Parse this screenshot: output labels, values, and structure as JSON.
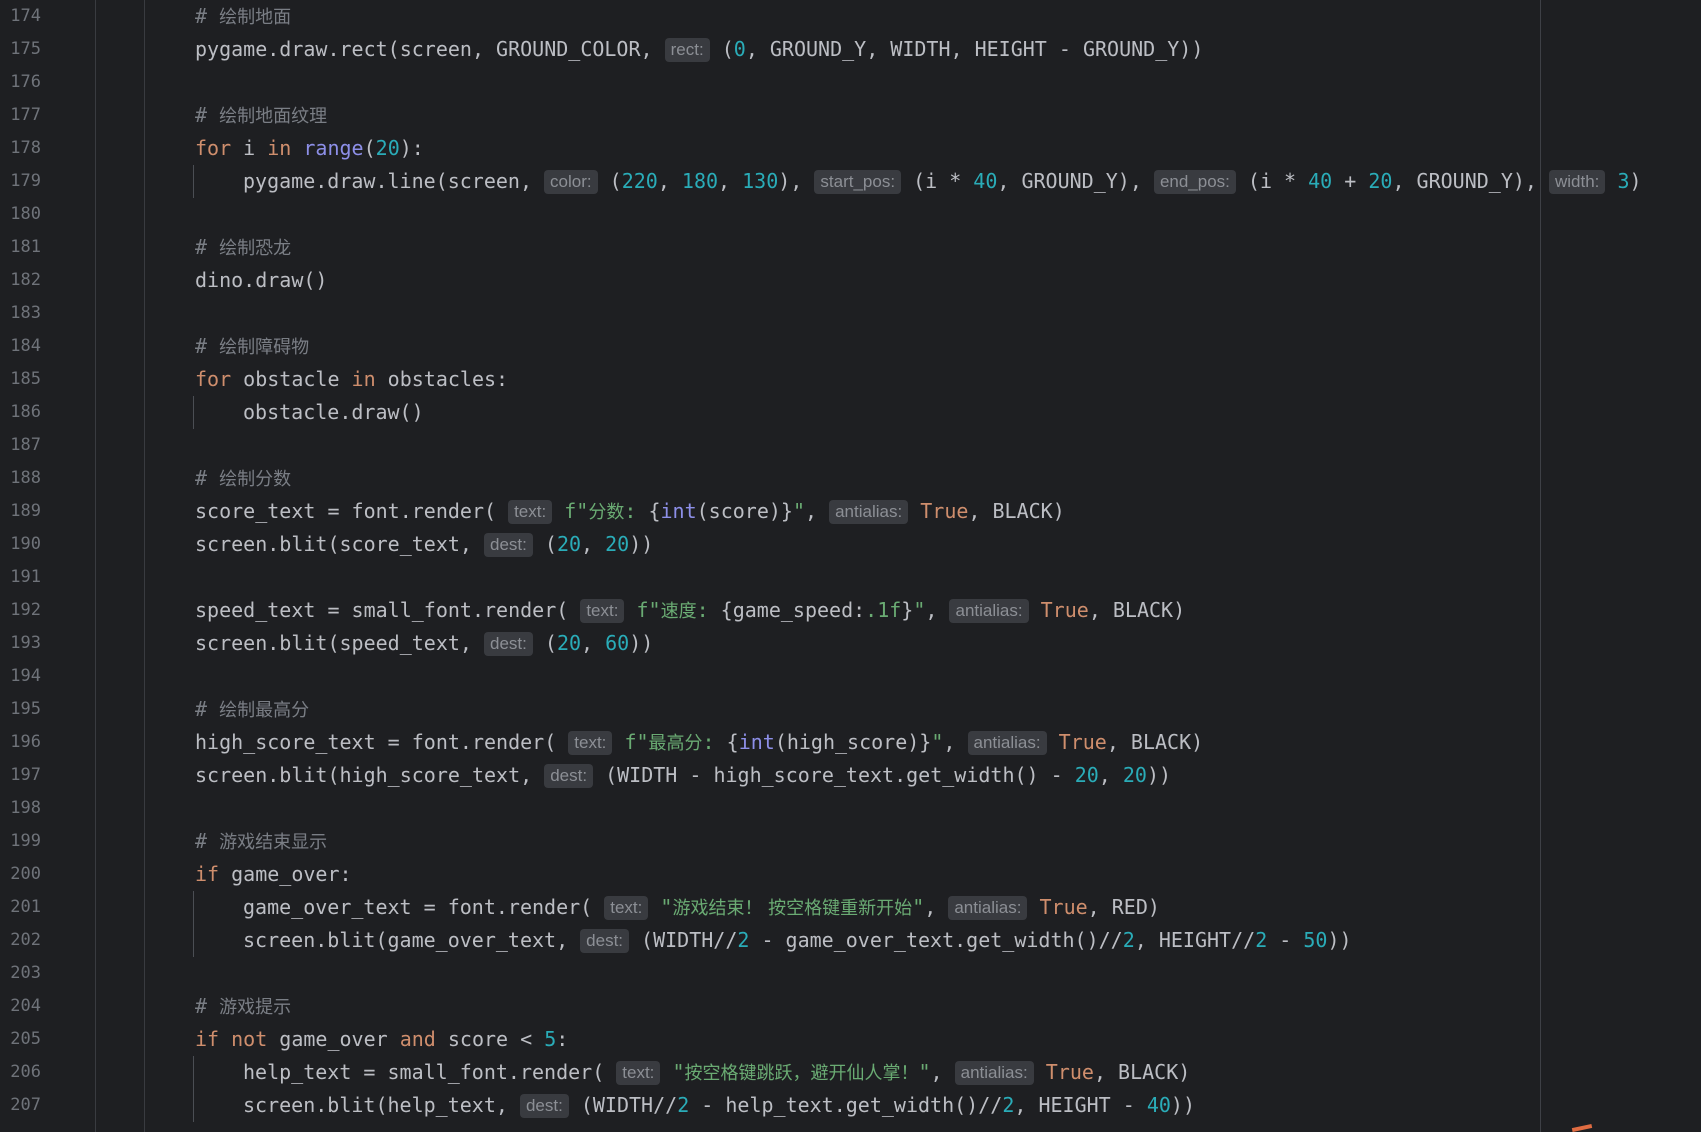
{
  "editor": {
    "lines": [
      {
        "n": "174",
        "indent": 1,
        "segs": [
          {
            "c": "cmt",
            "t": "# "
          },
          {
            "c": "cmt cjk",
            "t": "绘制地面"
          }
        ]
      },
      {
        "n": "175",
        "indent": 1,
        "segs": [
          {
            "t": "pygame.draw.rect(screen, GROUND_COLOR, "
          },
          {
            "h": "rect:"
          },
          {
            "t": " ("
          },
          {
            "c": "num",
            "t": "0"
          },
          {
            "t": ", GROUND_Y, WIDTH, HEIGHT - GROUND_Y))"
          }
        ]
      },
      {
        "n": "176",
        "indent": 0,
        "segs": []
      },
      {
        "n": "177",
        "indent": 1,
        "segs": [
          {
            "c": "cmt",
            "t": "# "
          },
          {
            "c": "cmt cjk",
            "t": "绘制地面纹理"
          }
        ]
      },
      {
        "n": "178",
        "indent": 1,
        "segs": [
          {
            "c": "kw",
            "t": "for"
          },
          {
            "t": " i "
          },
          {
            "c": "kw",
            "t": "in"
          },
          {
            "t": " "
          },
          {
            "c": "fn",
            "t": "range"
          },
          {
            "t": "("
          },
          {
            "c": "num",
            "t": "20"
          },
          {
            "t": "):"
          }
        ]
      },
      {
        "n": "179",
        "indent": 2,
        "segs": [
          {
            "t": "pygame.draw.line(screen, "
          },
          {
            "h": "color:"
          },
          {
            "t": " ("
          },
          {
            "c": "num",
            "t": "220"
          },
          {
            "t": ", "
          },
          {
            "c": "num",
            "t": "180"
          },
          {
            "t": ", "
          },
          {
            "c": "num",
            "t": "130"
          },
          {
            "t": "), "
          },
          {
            "h": "start_pos:"
          },
          {
            "t": " (i * "
          },
          {
            "c": "num",
            "t": "40"
          },
          {
            "t": ", GROUND_Y), "
          },
          {
            "h": "end_pos:"
          },
          {
            "t": " (i * "
          },
          {
            "c": "num",
            "t": "40"
          },
          {
            "t": " + "
          },
          {
            "c": "num",
            "t": "20"
          },
          {
            "t": ", GROUND_Y), "
          },
          {
            "h": "width:"
          },
          {
            "t": " "
          },
          {
            "c": "num",
            "t": "3"
          },
          {
            "t": ")"
          }
        ]
      },
      {
        "n": "180",
        "indent": 0,
        "segs": []
      },
      {
        "n": "181",
        "indent": 1,
        "segs": [
          {
            "c": "cmt",
            "t": "# "
          },
          {
            "c": "cmt cjk",
            "t": "绘制恐龙"
          }
        ]
      },
      {
        "n": "182",
        "indent": 1,
        "segs": [
          {
            "t": "dino.draw()"
          }
        ]
      },
      {
        "n": "183",
        "indent": 0,
        "segs": []
      },
      {
        "n": "184",
        "indent": 1,
        "segs": [
          {
            "c": "cmt",
            "t": "# "
          },
          {
            "c": "cmt cjk",
            "t": "绘制障碍物"
          }
        ]
      },
      {
        "n": "185",
        "indent": 1,
        "segs": [
          {
            "c": "kw",
            "t": "for"
          },
          {
            "t": " obstacle "
          },
          {
            "c": "kw",
            "t": "in"
          },
          {
            "t": " obstacles:"
          }
        ]
      },
      {
        "n": "186",
        "indent": 2,
        "segs": [
          {
            "t": "obstacle.draw()"
          }
        ]
      },
      {
        "n": "187",
        "indent": 0,
        "segs": []
      },
      {
        "n": "188",
        "indent": 1,
        "segs": [
          {
            "c": "cmt",
            "t": "# "
          },
          {
            "c": "cmt cjk",
            "t": "绘制分数"
          }
        ]
      },
      {
        "n": "189",
        "indent": 1,
        "segs": [
          {
            "t": "score_text = font.render( "
          },
          {
            "h": "text:"
          },
          {
            "t": " "
          },
          {
            "c": "str",
            "t": "f\""
          },
          {
            "c": "str cjk",
            "t": "分数"
          },
          {
            "c": "str",
            "t": ": "
          },
          {
            "t": "{"
          },
          {
            "c": "fn",
            "t": "int"
          },
          {
            "t": "(score)}"
          },
          {
            "c": "str",
            "t": "\""
          },
          {
            "t": ", "
          },
          {
            "h": "antialias:"
          },
          {
            "t": " "
          },
          {
            "c": "kw",
            "t": "True"
          },
          {
            "t": ", BLACK)"
          }
        ]
      },
      {
        "n": "190",
        "indent": 1,
        "segs": [
          {
            "t": "screen.blit(score_text, "
          },
          {
            "h": "dest:"
          },
          {
            "t": " ("
          },
          {
            "c": "num",
            "t": "20"
          },
          {
            "t": ", "
          },
          {
            "c": "num",
            "t": "20"
          },
          {
            "t": "))"
          }
        ]
      },
      {
        "n": "191",
        "indent": 0,
        "segs": []
      },
      {
        "n": "192",
        "indent": 1,
        "segs": [
          {
            "t": "speed_text = small_font.render( "
          },
          {
            "h": "text:"
          },
          {
            "t": " "
          },
          {
            "c": "str",
            "t": "f\""
          },
          {
            "c": "str cjk",
            "t": "速度"
          },
          {
            "c": "str",
            "t": ": "
          },
          {
            "t": "{game_speed:"
          },
          {
            "c": "str",
            "t": ".1f"
          },
          {
            "t": "}"
          },
          {
            "c": "str",
            "t": "\""
          },
          {
            "t": ", "
          },
          {
            "h": "antialias:"
          },
          {
            "t": " "
          },
          {
            "c": "kw",
            "t": "True"
          },
          {
            "t": ", BLACK)"
          }
        ]
      },
      {
        "n": "193",
        "indent": 1,
        "segs": [
          {
            "t": "screen.blit(speed_text, "
          },
          {
            "h": "dest:"
          },
          {
            "t": " ("
          },
          {
            "c": "num",
            "t": "20"
          },
          {
            "t": ", "
          },
          {
            "c": "num",
            "t": "60"
          },
          {
            "t": "))"
          }
        ]
      },
      {
        "n": "194",
        "indent": 0,
        "segs": []
      },
      {
        "n": "195",
        "indent": 1,
        "segs": [
          {
            "c": "cmt",
            "t": "# "
          },
          {
            "c": "cmt cjk",
            "t": "绘制最高分"
          }
        ]
      },
      {
        "n": "196",
        "indent": 1,
        "segs": [
          {
            "t": "high_score_text = font.render( "
          },
          {
            "h": "text:"
          },
          {
            "t": " "
          },
          {
            "c": "str",
            "t": "f\""
          },
          {
            "c": "str cjk",
            "t": "最高分"
          },
          {
            "c": "str",
            "t": ": "
          },
          {
            "t": "{"
          },
          {
            "c": "fn",
            "t": "int"
          },
          {
            "t": "(high_score)}"
          },
          {
            "c": "str",
            "t": "\""
          },
          {
            "t": ", "
          },
          {
            "h": "antialias:"
          },
          {
            "t": " "
          },
          {
            "c": "kw",
            "t": "True"
          },
          {
            "t": ", BLACK)"
          }
        ]
      },
      {
        "n": "197",
        "indent": 1,
        "segs": [
          {
            "t": "screen.blit(high_score_text, "
          },
          {
            "h": "dest:"
          },
          {
            "t": " (WIDTH - high_score_text.get_width() - "
          },
          {
            "c": "num",
            "t": "20"
          },
          {
            "t": ", "
          },
          {
            "c": "num",
            "t": "20"
          },
          {
            "t": "))"
          }
        ]
      },
      {
        "n": "198",
        "indent": 0,
        "segs": []
      },
      {
        "n": "199",
        "indent": 1,
        "segs": [
          {
            "c": "cmt",
            "t": "# "
          },
          {
            "c": "cmt cjk",
            "t": "游戏结束显示"
          }
        ]
      },
      {
        "n": "200",
        "indent": 1,
        "segs": [
          {
            "c": "kw",
            "t": "if"
          },
          {
            "t": " game_over:"
          }
        ]
      },
      {
        "n": "201",
        "indent": 2,
        "segs": [
          {
            "t": "game_over_text = font.render( "
          },
          {
            "h": "text:"
          },
          {
            "t": " "
          },
          {
            "c": "str",
            "t": "\""
          },
          {
            "c": "str cjk",
            "t": "游戏结束！ 按空格键重新开始"
          },
          {
            "c": "str",
            "t": "\""
          },
          {
            "t": ", "
          },
          {
            "h": "antialias:"
          },
          {
            "t": " "
          },
          {
            "c": "kw",
            "t": "True"
          },
          {
            "t": ", RED)"
          }
        ]
      },
      {
        "n": "202",
        "indent": 2,
        "segs": [
          {
            "t": "screen.blit(game_over_text, "
          },
          {
            "h": "dest:"
          },
          {
            "t": " (WIDTH//"
          },
          {
            "c": "num",
            "t": "2"
          },
          {
            "t": " - game_over_text.get_width()//"
          },
          {
            "c": "num",
            "t": "2"
          },
          {
            "t": ", HEIGHT//"
          },
          {
            "c": "num",
            "t": "2"
          },
          {
            "t": " - "
          },
          {
            "c": "num",
            "t": "50"
          },
          {
            "t": "))"
          }
        ]
      },
      {
        "n": "203",
        "indent": 0,
        "segs": []
      },
      {
        "n": "204",
        "indent": 1,
        "segs": [
          {
            "c": "cmt",
            "t": "# "
          },
          {
            "c": "cmt cjk",
            "t": "游戏提示"
          }
        ]
      },
      {
        "n": "205",
        "indent": 1,
        "segs": [
          {
            "c": "kw",
            "t": "if not"
          },
          {
            "t": " game_over "
          },
          {
            "c": "kw",
            "t": "and"
          },
          {
            "t": " score < "
          },
          {
            "c": "num",
            "t": "5"
          },
          {
            "t": ":"
          }
        ]
      },
      {
        "n": "206",
        "indent": 2,
        "segs": [
          {
            "t": "help_text = small_font.render( "
          },
          {
            "h": "text:"
          },
          {
            "t": " "
          },
          {
            "c": "str",
            "t": "\""
          },
          {
            "c": "str cjk",
            "t": "按空格键跳跃，避开仙人掌！"
          },
          {
            "c": "str",
            "t": "\""
          },
          {
            "t": ", "
          },
          {
            "h": "antialias:"
          },
          {
            "t": " "
          },
          {
            "c": "kw",
            "t": "True"
          },
          {
            "t": ", BLACK)"
          }
        ]
      },
      {
        "n": "207",
        "indent": 2,
        "segs": [
          {
            "t": "screen.blit(help_text, "
          },
          {
            "h": "dest:"
          },
          {
            "t": " (WIDTH//"
          },
          {
            "c": "num",
            "t": "2"
          },
          {
            "t": " - help_text.get_width()//"
          },
          {
            "c": "num",
            "t": "2"
          },
          {
            "t": ", HEIGHT - "
          },
          {
            "c": "num",
            "t": "40"
          },
          {
            "t": "))"
          }
        ]
      }
    ]
  },
  "colors": {
    "background": "#1e1f22",
    "keyword": "#cf8e6d",
    "number": "#2aacb8",
    "string": "#6aab73",
    "builtin": "#8d8fe8",
    "comment": "#7a7e85",
    "hint_bg": "#393b40"
  }
}
